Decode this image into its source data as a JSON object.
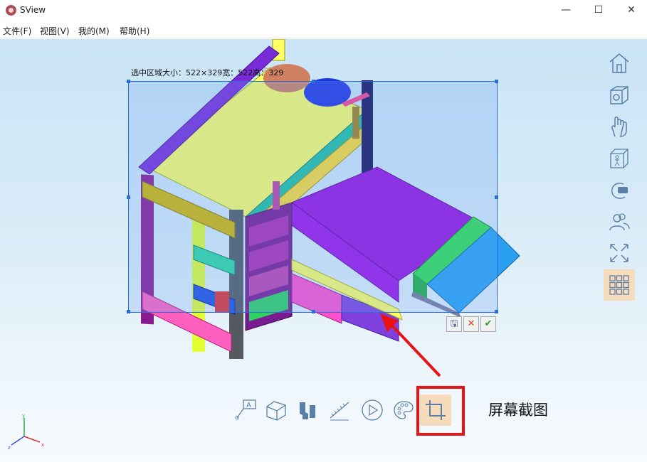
{
  "window": {
    "title": "SView",
    "min_glyph": "—",
    "max_glyph": "☐",
    "close_glyph": "✕"
  },
  "menu": [
    "文件(F)",
    "视图(V)",
    "我的(M)",
    "帮助(H)"
  ],
  "selection": {
    "label": "选中区域大小：522×329宽：522高：329",
    "tools": {
      "save": "🖫",
      "cancel": "✕",
      "ok": "✔"
    }
  },
  "right_toolbar": [
    {
      "icon": "home-icon",
      "active": false
    },
    {
      "icon": "model-settings-icon",
      "active": false
    },
    {
      "icon": "hand-icon",
      "active": false
    },
    {
      "icon": "person-in-box-icon",
      "active": false
    },
    {
      "icon": "vr-headset-icon",
      "active": false
    },
    {
      "icon": "users-icon",
      "active": false
    },
    {
      "icon": "fullscreen-icon",
      "active": false
    },
    {
      "icon": "grid-icon",
      "active": true
    }
  ],
  "bottom_toolbar": [
    {
      "icon": "annotation-icon",
      "active": false
    },
    {
      "icon": "section-cut-icon",
      "active": false
    },
    {
      "icon": "explode-icon",
      "active": false
    },
    {
      "icon": "measure-icon",
      "active": false
    },
    {
      "icon": "play-icon",
      "active": false
    },
    {
      "icon": "palette-icon",
      "active": false
    },
    {
      "icon": "screenshot-crop-icon",
      "active": true
    }
  ],
  "callout_text": "屏幕截图",
  "axes": {
    "x": "x",
    "y": "y",
    "z": "z"
  },
  "colors": {
    "selection": "#2a6cd8",
    "highlight": "#e81313",
    "active_tool": "#f7dcbc"
  }
}
